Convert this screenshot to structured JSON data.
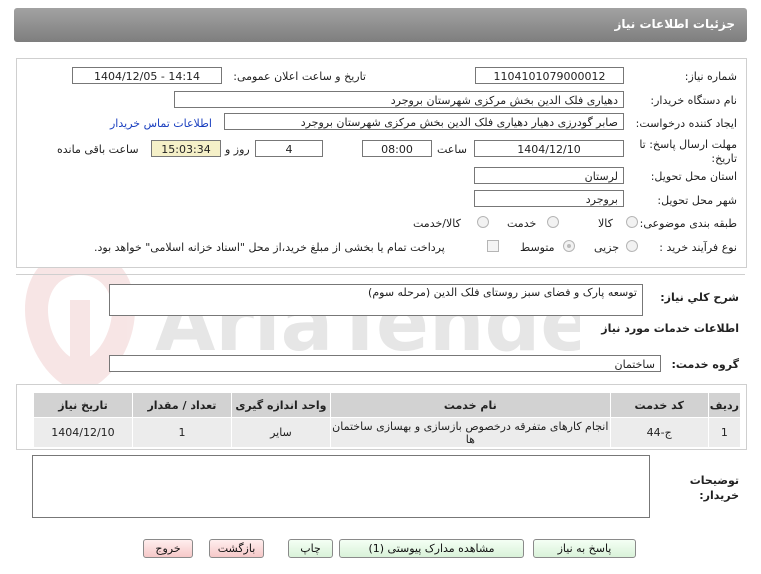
{
  "title": "جزئیات اطلاعات نیاز",
  "labels": {
    "need_number": "شماره نیاز:",
    "announce_datetime": "تاریخ و ساعت اعلان عمومی:",
    "buyer_org": "نام دستگاه خریدار:",
    "requester": "ایجاد کننده درخواست:",
    "contact_link": "اطلاعات تماس خریدار",
    "deadline_line1": "مهلت ارسال پاسخ: تا",
    "deadline_line2": "تاریخ:",
    "time_word": "ساعت",
    "day_word": "روز و",
    "remaining": "ساعت باقی مانده",
    "province": "استان محل تحویل:",
    "city": "شهر محل تحویل:",
    "category": "طبقه بندی موضوعی:",
    "process_type": "نوع فرآیند خرید :",
    "description": "شرح کلي نياز:",
    "services_info": "اطلاعات خدمات مورد نیاز",
    "service_group": "گروه خدمت:",
    "buyer_notes_line1": "توضیحات",
    "buyer_notes_line2": "خریدار:"
  },
  "values": {
    "need_number": "1104101079000012",
    "announce_datetime": "1404/12/05 - 14:14",
    "buyer_org": "دهیاری فلک الدین بخش مرکزی شهرستان بروجرد",
    "requester": "صابر گودرزی دهیار دهیاری فلک الدین بخش مرکزی شهرستان بروجرد",
    "deadline_date": "1404/12/10",
    "deadline_time": "08:00",
    "days": "4",
    "remaining_time": "15:03:34",
    "province": "لرستان",
    "city": "بروجرد",
    "description": "توسعه پارک و فضای سبز روستای فلک الدین (مرحله سوم)",
    "service_group": "ساختمان",
    "buyer_notes": ""
  },
  "category_options": [
    "کالا",
    "خدمت",
    "کالا/خدمت"
  ],
  "process_options": [
    "جزیی",
    "متوسط"
  ],
  "process_note": "پرداخت تمام یا بخشی از مبلغ خرید،از محل \"اسناد خزانه اسلامی\" خواهد بود.",
  "table": {
    "headers": [
      "ردیف",
      "کد خدمت",
      "نام خدمت",
      "واحد اندازه گیری",
      "تعداد / مقدار",
      "تاریخ نیاز"
    ],
    "rows": [
      [
        "1",
        "ج-44",
        "انجام کارهای متفرقه درخصوص بازسازی و بهسازی ساختمان ها",
        "سایر",
        "1",
        "1404/12/10"
      ]
    ]
  },
  "buttons": {
    "reply": "پاسخ به نیاز",
    "view_docs": "مشاهده مدارک پیوستی (1)",
    "print": "چاپ",
    "back": "بازگشت",
    "exit": "خروج"
  },
  "watermark": "AriaTender.net",
  "colors": {
    "header_bg": "#8c8c8c",
    "link": "#1a3fbf",
    "remaining_bg": "#f5f0c8",
    "green_btn": "#d9f2d9",
    "pink_btn": "#f6c8c8"
  }
}
